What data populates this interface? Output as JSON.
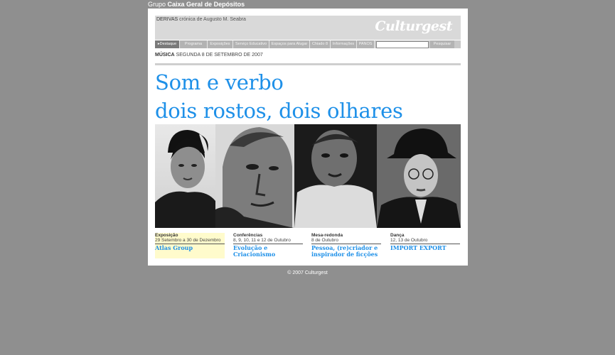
{
  "topbar": {
    "prefix": "Grupo",
    "group": "Caixa Geral de Depósitos"
  },
  "header": {
    "section": "DERIVAS",
    "byline": "crónica de Augusto M. Seabra",
    "logo": "Culturgest"
  },
  "nav": {
    "items": [
      "Destaque",
      "Programa",
      "Exposições",
      "Serviço Educativo",
      "Espaços para Alugar",
      "Chiado 8",
      "Informações",
      "PANOS"
    ],
    "active_index": 0,
    "search_button": "Pesquisar"
  },
  "dateline": {
    "category": "MÚSICA",
    "date": "SEGUNDA 8 DE SETEMBRO DE 2007"
  },
  "headline": {
    "line1": "Som e verbo",
    "line2": "dois rostos, dois olhares"
  },
  "events": [
    {
      "category": "Exposição",
      "date": "29 Setembro a 30 de Dezembro",
      "title": "Atlas Group"
    },
    {
      "category": "Conferências",
      "date": "8, 9, 10, 11 e 12 de Outubro",
      "title": "Evolução e Criacionismo"
    },
    {
      "category": "Mesa-redonda",
      "date": "8 de Outubro",
      "title": "Pessoa, (re)criador e inspirador de ficções"
    },
    {
      "category": "Dança",
      "date": "12, 13 de Outubro",
      "title": "IMPORT EXPORT"
    }
  ],
  "footer": {
    "text": "© 2007 Culturgest"
  },
  "colors": {
    "page_bg": "#8f8f8f",
    "accent_blue": "#1e90e8",
    "highlight": "#fffbcc"
  }
}
